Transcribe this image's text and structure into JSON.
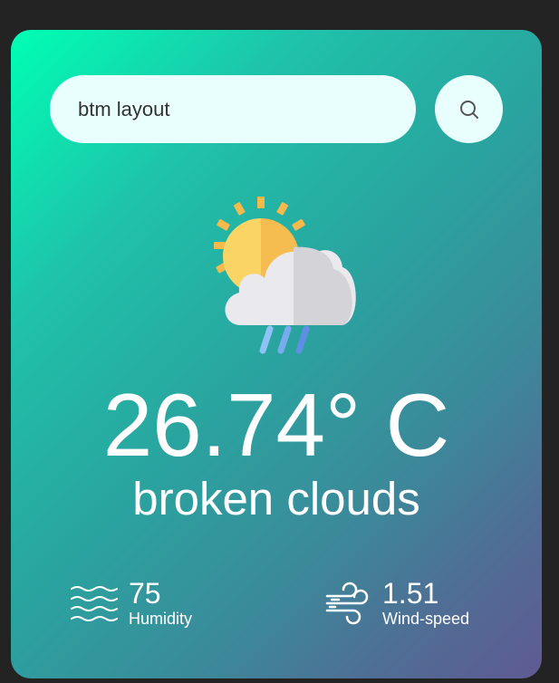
{
  "search": {
    "value": "btm layout",
    "button_icon": "search-icon"
  },
  "weather": {
    "icon": "sun-cloud-rain-icon",
    "temperature": "26.74° C",
    "description": "broken clouds"
  },
  "humidity": {
    "value": "75",
    "label": "Humidity",
    "icon": "humidity-waves-icon"
  },
  "wind": {
    "value": "1.51",
    "label": "Wind-speed",
    "icon": "wind-icon"
  }
}
